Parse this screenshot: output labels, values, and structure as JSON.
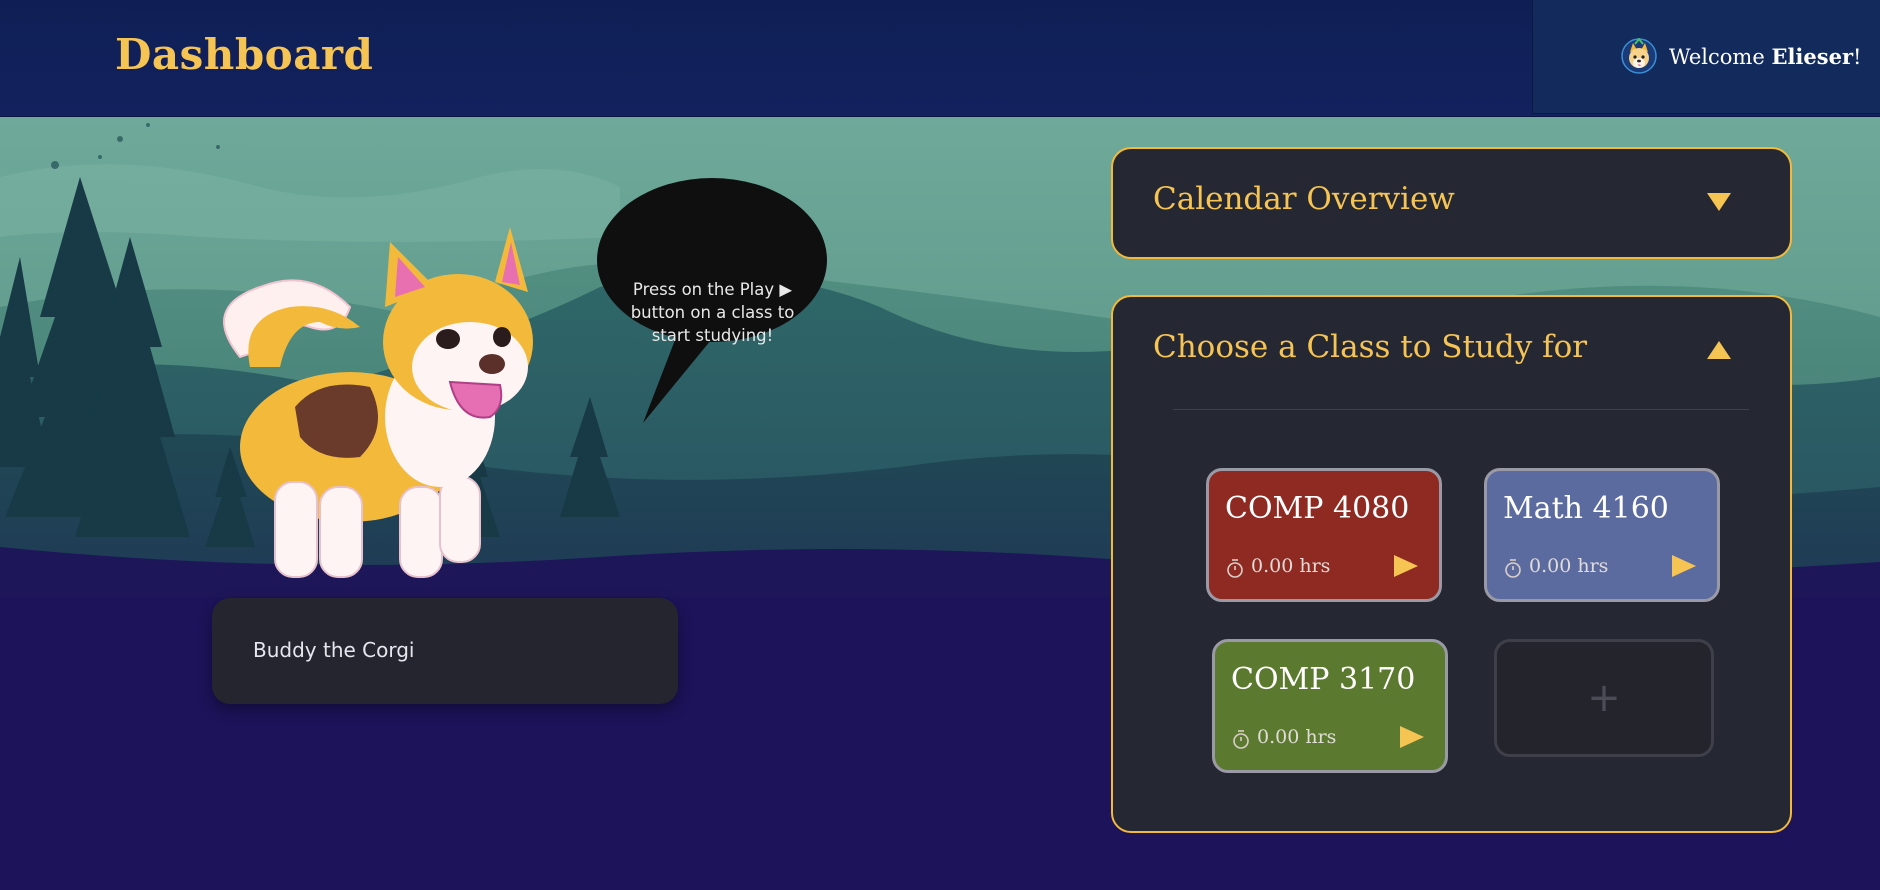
{
  "header": {
    "title": "Dashboard",
    "welcome_prefix": "Welcome ",
    "user_name": "Elieser",
    "welcome_suffix": "!",
    "avatar_icon": "corgi-avatar-icon"
  },
  "pet": {
    "speech": "Press on the Play ▶ button on a class to start studying!",
    "name": "Buddy the Corgi"
  },
  "calendar_panel": {
    "title": "Calendar Overview",
    "toggle_icon": "chevron-down-icon"
  },
  "classes_panel": {
    "title": "Choose a Class to Study for",
    "toggle_icon": "chevron-up-icon",
    "classes": [
      {
        "name": "COMP 4080",
        "time": "0.00 hrs",
        "color": "#8e2a22"
      },
      {
        "name": "Math 4160",
        "time": "0.00 hrs",
        "color": "#5c6b9f"
      },
      {
        "name": "COMP 3170",
        "time": "0.00 hrs",
        "color": "#5c7a2f"
      }
    ],
    "add_label": "+"
  },
  "colors": {
    "accent": "#f6c453",
    "header_bg": "#13215e",
    "panel_bg": "#252833",
    "page_bg": "#1c135a"
  }
}
